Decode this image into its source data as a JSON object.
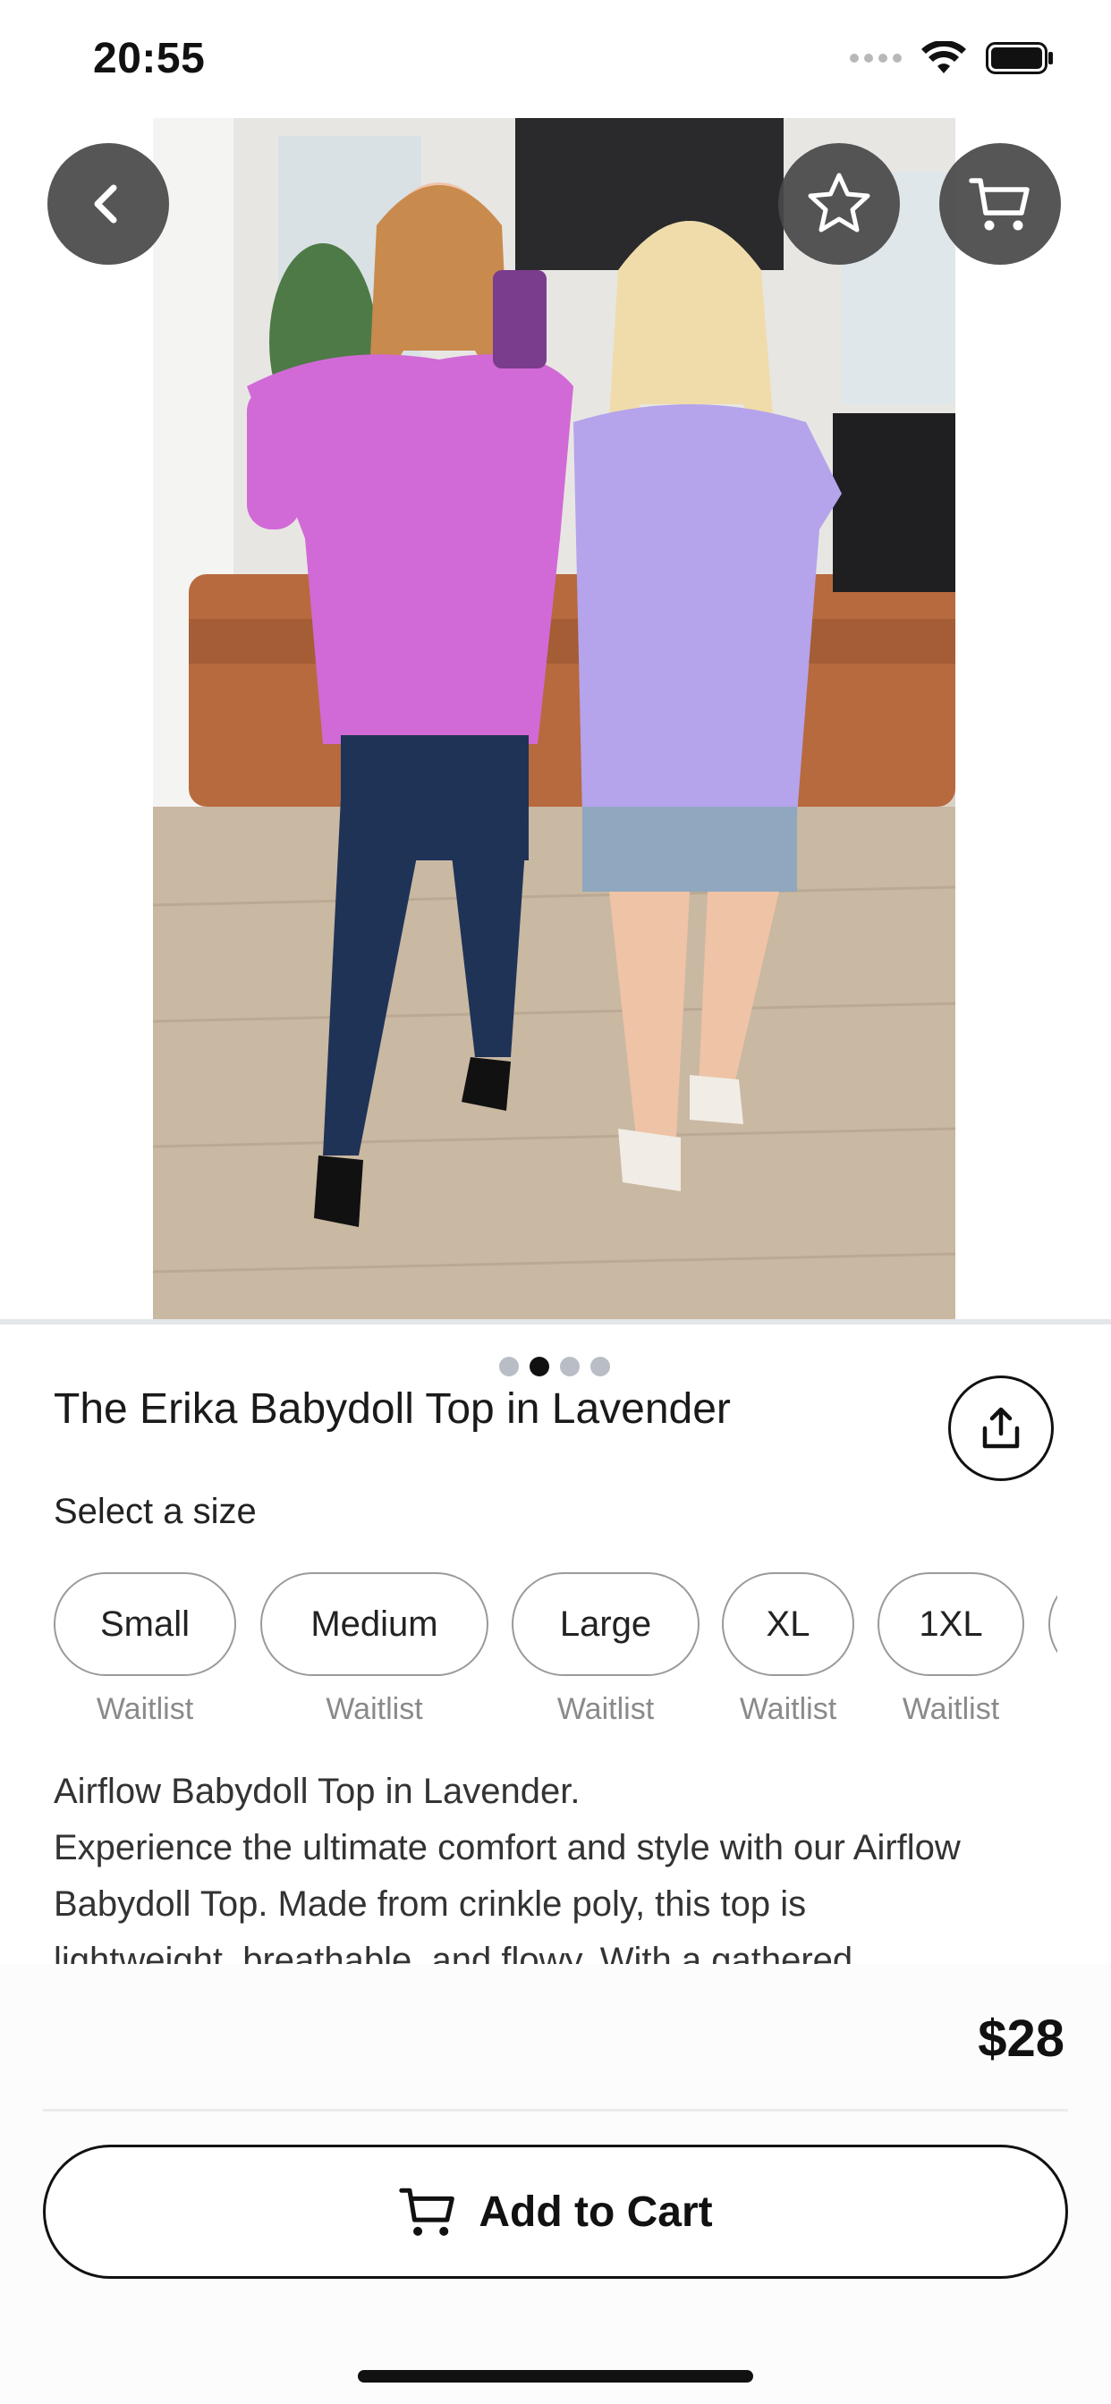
{
  "status_bar": {
    "time": "20:55"
  },
  "product": {
    "title": "The Erika Babydoll Top in Lavender",
    "price": "$28",
    "image_pager": {
      "count": 4,
      "active_index": 1
    }
  },
  "size_selector": {
    "label": "Select a size",
    "options": [
      {
        "label": "Small",
        "status": "Waitlist"
      },
      {
        "label": "Medium",
        "status": "Waitlist"
      },
      {
        "label": "Large",
        "status": "Waitlist"
      },
      {
        "label": "XL",
        "status": "Waitlist"
      },
      {
        "label": "1XL",
        "status": "Waitlist"
      }
    ]
  },
  "description": {
    "lines": [
      "Airflow Babydoll Top in Lavender.",
      "Experience the ultimate comfort and style with our Airflow",
      "Babydoll Top. Made from crinkle poly, this top is",
      "lightweight, breathable, and flowy. With a gathered"
    ]
  },
  "actions": {
    "add_to_cart": "Add to Cart"
  },
  "icons": {
    "back": "chevron-left-icon",
    "favorite": "star-icon",
    "cart": "cart-icon",
    "share": "share-icon"
  },
  "colors": {
    "overlay_button": "#484848",
    "pager_active": "#111111",
    "pager_inactive": "#b9bec6",
    "photo_top_left": "#d16ad6",
    "photo_top_right": "#b5a3eb"
  }
}
